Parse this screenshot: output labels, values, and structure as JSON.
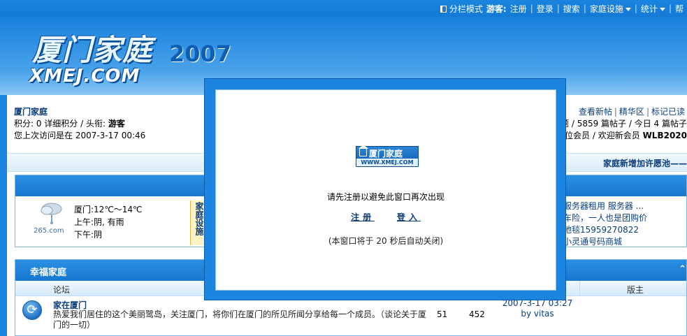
{
  "topbar": {
    "layout_mode": "分栏模式",
    "guest_prefix": "游客:",
    "links": [
      "注册",
      "登录",
      "搜索",
      "家庭设施",
      "统计",
      "帮"
    ]
  },
  "logo": {
    "name": "厦门家庭",
    "domain": "XMEJ.COM",
    "year": "2007"
  },
  "userinfo": {
    "title": "厦门家庭",
    "points_line_prefix": "积分: 0 详细积分 / 头衔:",
    "rank": "游客",
    "last_visit": "您上次访问是在 2007-3-17 00:46"
  },
  "nav_right": {
    "links": [
      "查看新帖",
      "精华区",
      "标记已读"
    ],
    "stats_line": "题 / 5859 篇帖子 / 今日 4 篇帖子",
    "members_line_prefix": "位会员 / 欢迎新会员",
    "new_member": "WLB2020"
  },
  "announce": {
    "text": "家庭新增加许愿池——"
  },
  "weather": {
    "brand": "265.com",
    "city_line": "厦门:12℃～14℃",
    "morning": "上午:阴, 有雨",
    "afternoon": "下午:阴",
    "ad_vertical": "家庭设施"
  },
  "right_ads": [
    "服务器租用 服务器 ...",
    "车险，一人也是团购价",
    "地毯15959270822",
    "小灵通号码商城"
  ],
  "forum": {
    "section_title": "幸福家庭",
    "collapse_icon": "⌃",
    "col_forum": "论坛",
    "col_moderator": "版主",
    "rows": [
      {
        "title": "家在厦门",
        "desc": "热爱我们居住的这个美丽鹭岛，关注厦门，将你们在厦门的所见所闻分享给每一个成员。（谈论关于厦门的一切）",
        "threads": "51",
        "posts": "452",
        "last_time": "2007-3-17 03:27",
        "last_by": "by vitas"
      }
    ]
  },
  "modal": {
    "logo_cn": "厦门家庭",
    "logo_en": "WWW.XMEJ.COM",
    "notice": "请先注册以避免此窗口再次出现",
    "register": "注册",
    "login": "登入",
    "autoclose": "(本窗口将于 20 秒后自动关闭)"
  }
}
